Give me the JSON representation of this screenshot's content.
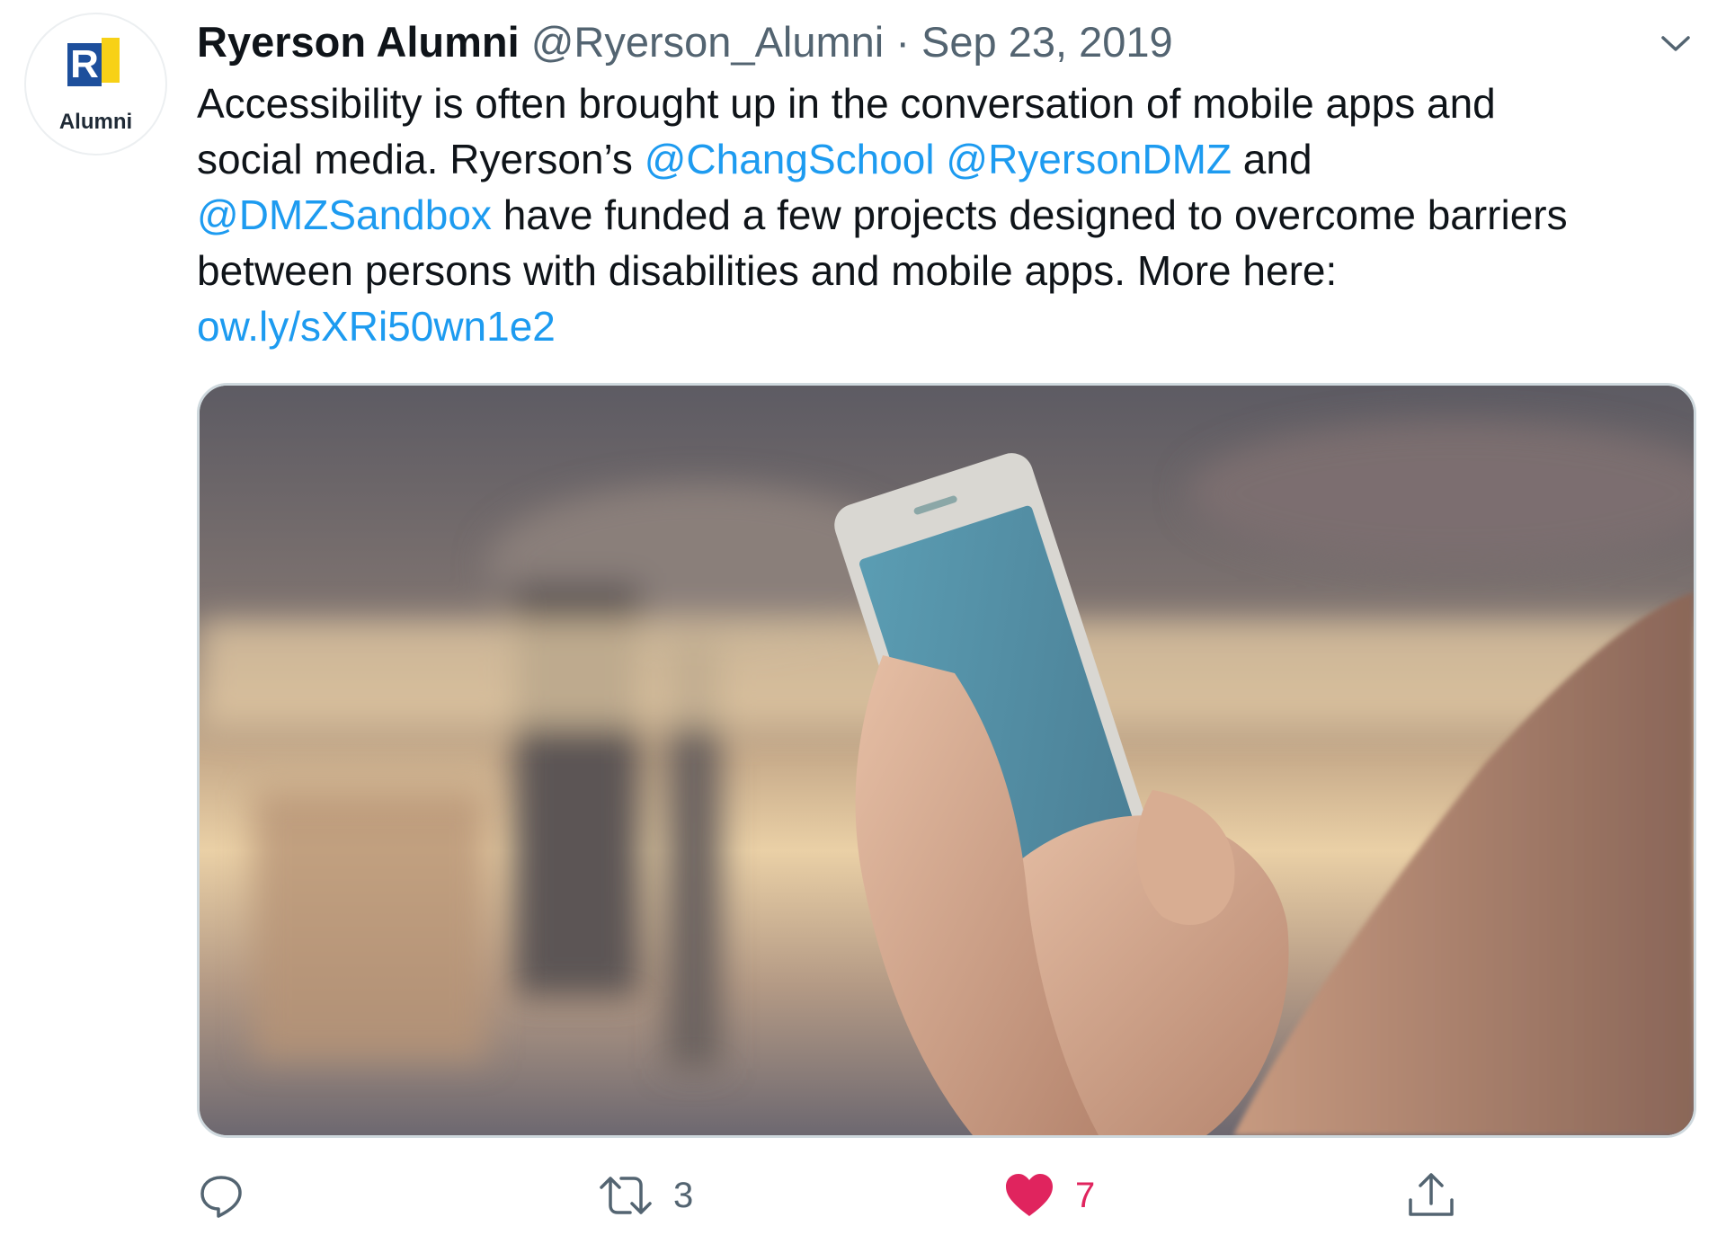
{
  "tweet": {
    "avatar": {
      "logo_letter": "R",
      "logo_text": "Alumni",
      "icon": "ryerson-alumni-logo-icon"
    },
    "author": {
      "name": "Ryerson Alumni",
      "handle": "@Ryerson_Alumni",
      "separator": "·",
      "date": "Sep 23, 2019"
    },
    "text": {
      "line1": "Accessibility is often brought up in the conversation of mobile apps and",
      "line2_a": "social media. Ryerson’s ",
      "mention1": "@ChangSchool",
      "line2_b": " ",
      "mention2": "@RyersonDMZ",
      "line2_c": " and",
      "mention3": "@DMZSandbox",
      "line3_b": " have funded a few projects designed to overcome barriers",
      "line4": "between persons with disabilities and mobile apps. More here:",
      "link": "ow.ly/sXRi50wn1e2"
    },
    "media": {
      "description_icon": "phone-in-hands-photo"
    },
    "actions": {
      "reply": {
        "icon": "reply-bubble-icon",
        "count": ""
      },
      "retweet": {
        "icon": "retweet-icon",
        "count": "3"
      },
      "like": {
        "icon": "heart-filled-icon",
        "count": "7",
        "liked": true
      },
      "share": {
        "icon": "share-upload-icon"
      }
    },
    "more_menu_icon": "chevron-down-icon",
    "colors": {
      "link": "#1d9bf0",
      "muted": "#536471",
      "like": "#e0245e",
      "text": "#0f1419"
    }
  }
}
